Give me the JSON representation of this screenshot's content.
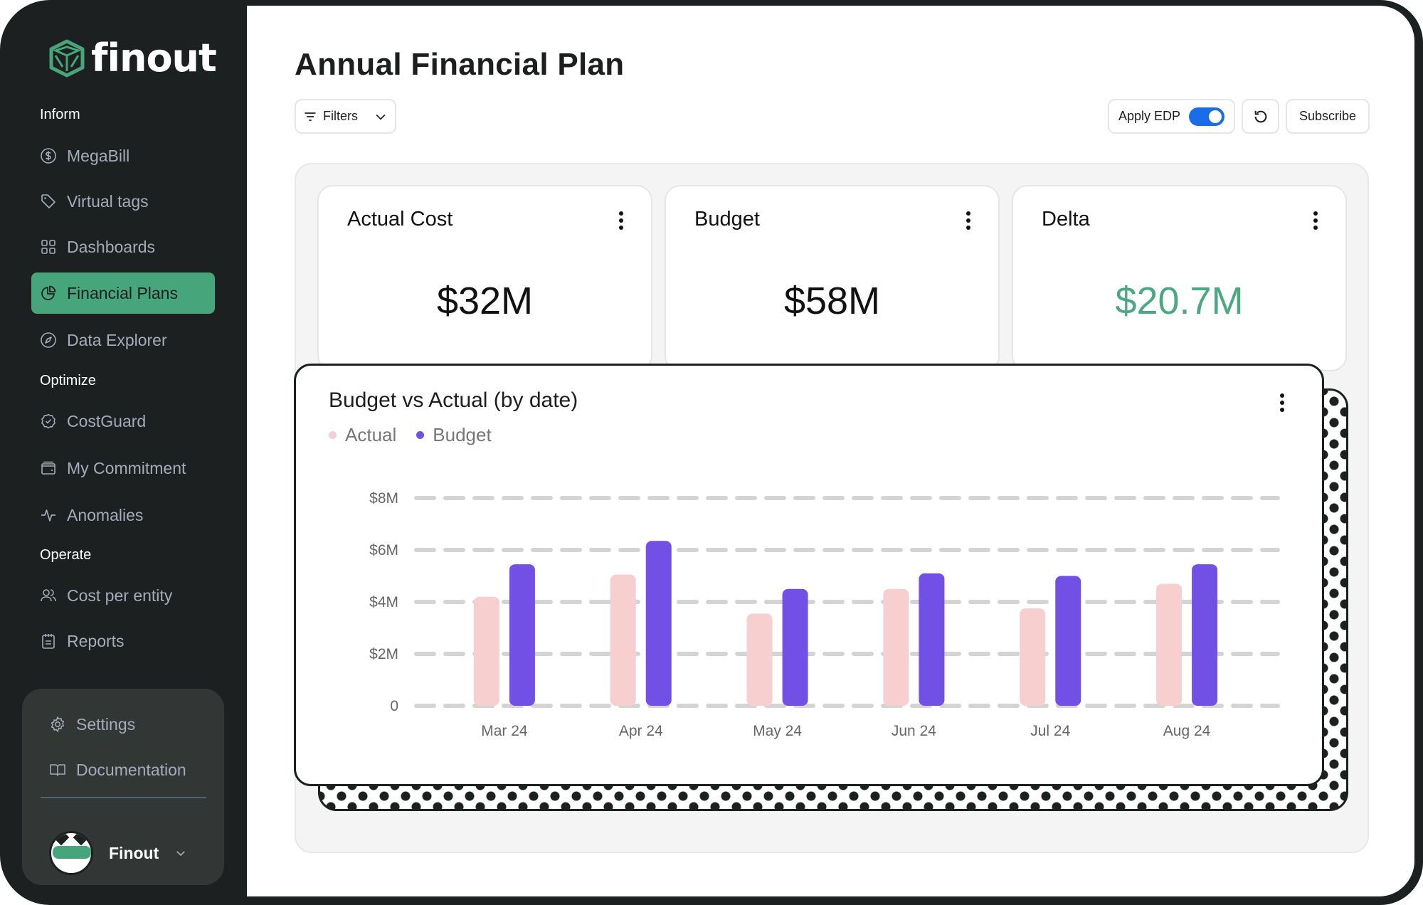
{
  "app": {
    "brand": "finout",
    "brand_color": "#47a57c"
  },
  "sidebar": {
    "sections": [
      {
        "label": "Inform"
      },
      {
        "label": "Optimize"
      },
      {
        "label": "Operate"
      }
    ],
    "items": [
      {
        "label": "MegaBill",
        "icon": "dollar-circle-icon",
        "active": false
      },
      {
        "label": "Virtual tags",
        "icon": "tag-icon",
        "active": false
      },
      {
        "label": "Dashboards",
        "icon": "grid-icon",
        "active": false
      },
      {
        "label": "Financial Plans",
        "icon": "pie-chart-icon",
        "active": true
      },
      {
        "label": "Data Explorer",
        "icon": "compass-icon",
        "active": false
      },
      {
        "label": "CostGuard",
        "icon": "badge-check-icon",
        "active": false
      },
      {
        "label": "My Commitment",
        "icon": "wallet-icon",
        "active": false
      },
      {
        "label": "Anomalies",
        "icon": "activity-icon",
        "active": false
      },
      {
        "label": "Cost per entity",
        "icon": "users-icon",
        "active": false
      },
      {
        "label": "Reports",
        "icon": "clipboard-icon",
        "active": false
      }
    ],
    "bottom": {
      "settings_label": "Settings",
      "documentation_label": "Documentation",
      "user_name": "Finout"
    }
  },
  "header": {
    "title": "Annual Financial Plan",
    "filters_label": "Filters",
    "apply_edp_label": "Apply EDP",
    "apply_edp_enabled": true,
    "subscribe_label": "Subscribe"
  },
  "kpis": [
    {
      "title": "Actual Cost",
      "value": "$32M",
      "status": "neutral"
    },
    {
      "title": "Budget",
      "value": "$58M",
      "status": "neutral"
    },
    {
      "title": "Delta",
      "value": "$20.7M",
      "status": "positive",
      "color": "#4ba883"
    }
  ],
  "chart": {
    "title": "Budget vs Actual (by date)",
    "legend": [
      {
        "label": "Actual",
        "color": "#f7cfcf"
      },
      {
        "label": "Budget",
        "color": "#7250e6"
      }
    ]
  },
  "chart_data": {
    "type": "bar",
    "title": "Budget vs Actual (by date)",
    "xlabel": "",
    "ylabel": "",
    "categories": [
      "Mar 24",
      "Apr 24",
      "May 24",
      "Jun 24",
      "Jul 24",
      "Aug 24"
    ],
    "series": [
      {
        "name": "Actual",
        "color": "#f7cfcf",
        "values": [
          4.2,
          5.05,
          3.55,
          4.5,
          3.75,
          4.7
        ]
      },
      {
        "name": "Budget",
        "color": "#7250e6",
        "values": [
          5.45,
          6.35,
          4.5,
          5.1,
          5.0,
          5.45
        ]
      }
    ],
    "unit": "$M",
    "ylim": [
      0,
      8
    ],
    "yticks": [
      0,
      2,
      4,
      6,
      8
    ],
    "ytick_labels": [
      "0",
      "$2M",
      "$4M",
      "$6M",
      "$8M"
    ],
    "grid": true,
    "grid_style": "dashed",
    "legend_position": "top-left"
  }
}
